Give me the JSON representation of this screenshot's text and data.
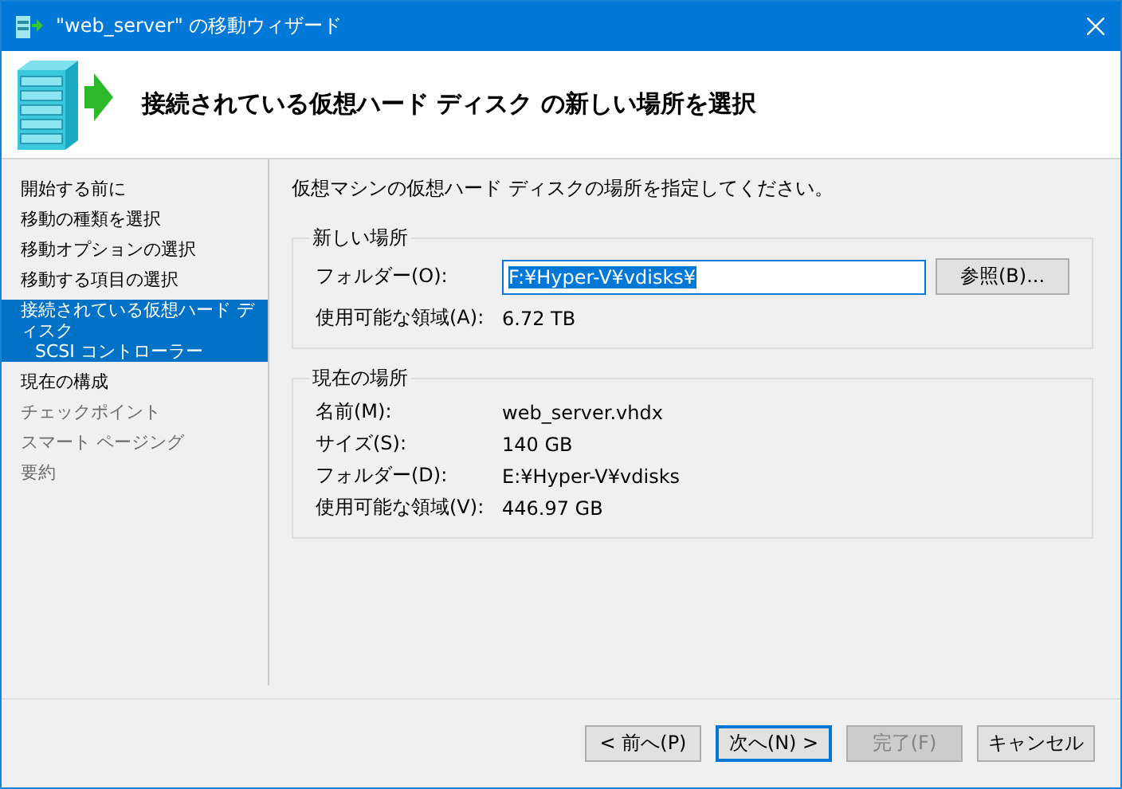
{
  "window": {
    "title": "\"web_server\" の移動ウィザード"
  },
  "header": {
    "title": "接続されている仮想ハード ディスク の新しい場所を選択"
  },
  "sidebar": {
    "items": [
      {
        "label": "開始する前に",
        "selected": false,
        "disabled": false
      },
      {
        "label": "移動の種類を選択",
        "selected": false,
        "disabled": false
      },
      {
        "label": "移動オプションの選択",
        "selected": false,
        "disabled": false
      },
      {
        "label": "移動する項目の選択",
        "selected": false,
        "disabled": false
      },
      {
        "label": "接続されている仮想ハード ディスク",
        "selected": true,
        "disabled": false,
        "children": [
          {
            "label": "SCSI コントローラー"
          }
        ]
      },
      {
        "label": "現在の構成",
        "selected": false,
        "disabled": false
      },
      {
        "label": "チェックポイント",
        "selected": false,
        "disabled": true
      },
      {
        "label": "スマート ページング",
        "selected": false,
        "disabled": true
      },
      {
        "label": "要約",
        "selected": false,
        "disabled": true
      }
    ]
  },
  "instruction": "仮想マシンの仮想ハード ディスクの場所を指定してください。",
  "new_location": {
    "title": "新しい場所",
    "folder_label": "フォルダー(O):",
    "folder_value": "F:¥Hyper-V¥vdisks¥",
    "folder_text_selected": true,
    "browse_button": "参照(B)...",
    "space_label": "使用可能な領域(A):",
    "space_value": "6.72 TB"
  },
  "current_location": {
    "title": "現在の場所",
    "rows": [
      {
        "label": "名前(M):",
        "value": "web_server.vhdx"
      },
      {
        "label": "サイズ(S):",
        "value": "140 GB"
      },
      {
        "label": "フォルダー(D):",
        "value": "E:¥Hyper-V¥vdisks"
      },
      {
        "label": "使用可能な領域(V):",
        "value": "446.97 GB"
      }
    ]
  },
  "buttons": [
    {
      "label": "< 前へ(P)",
      "default": false,
      "disabled": false
    },
    {
      "label": "次へ(N) >",
      "default": true,
      "disabled": false
    },
    {
      "label": "完了(F)",
      "default": false,
      "disabled": true
    },
    {
      "label": "キャンセル",
      "default": false,
      "disabled": false
    }
  ]
}
